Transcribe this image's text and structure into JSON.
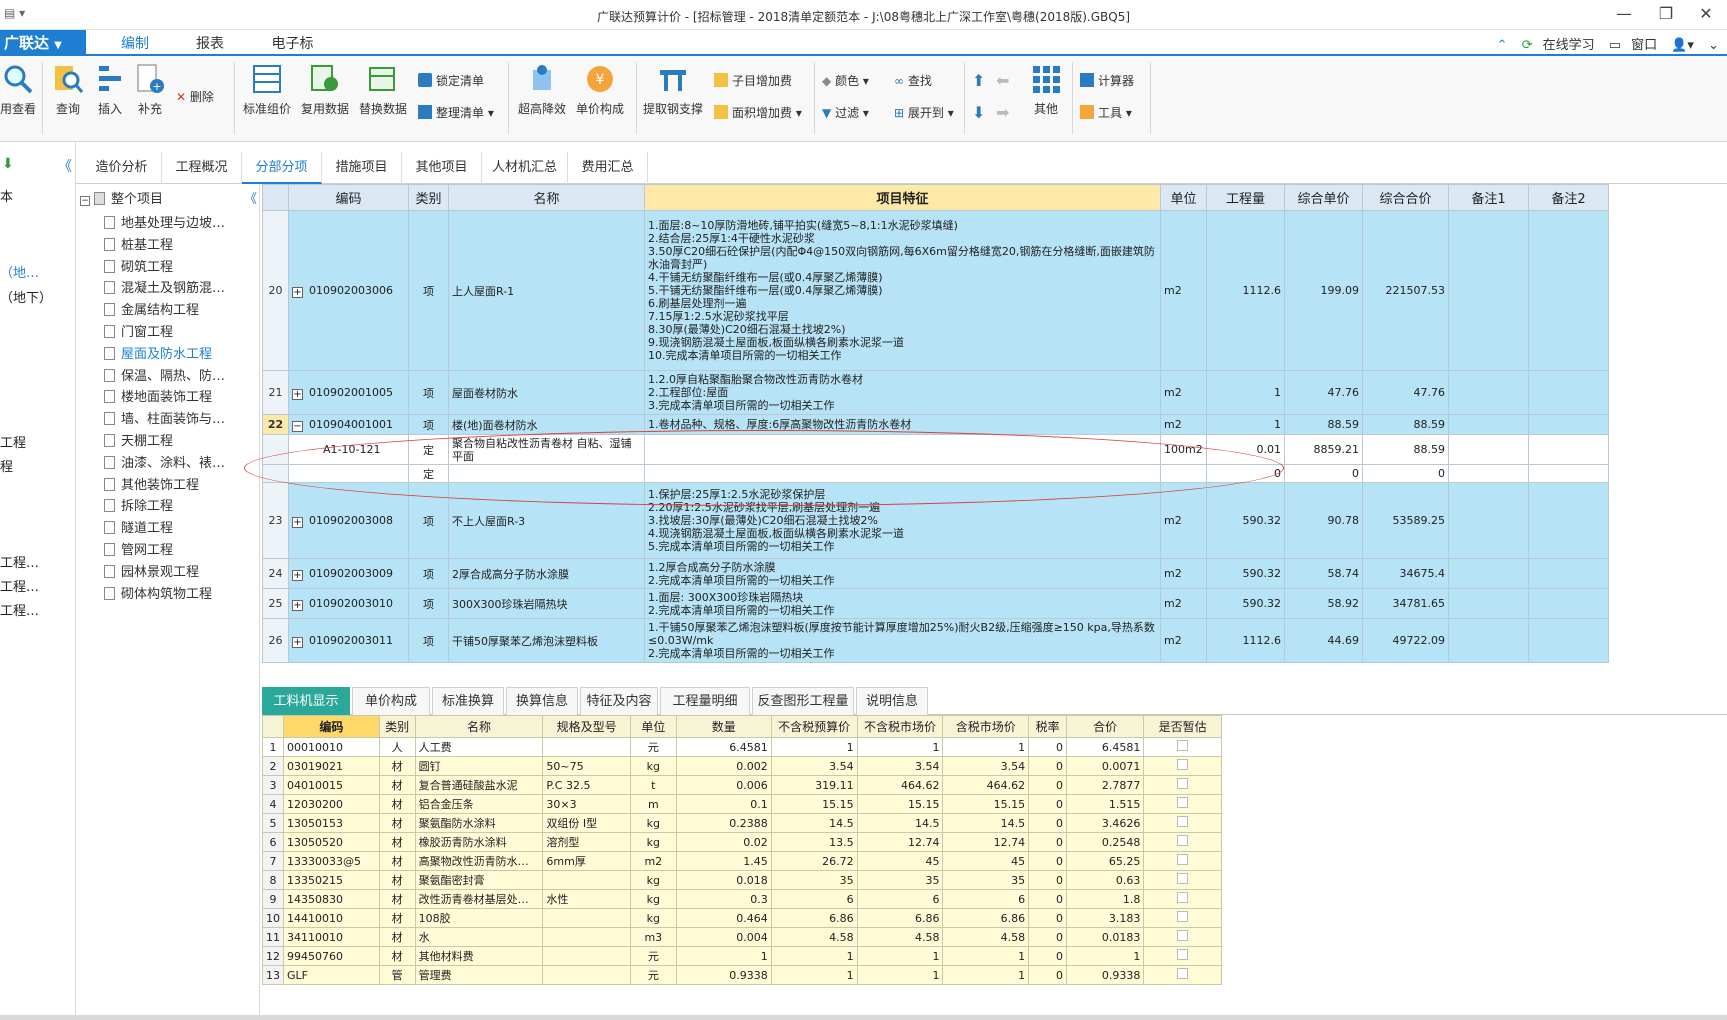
{
  "window": {
    "title": "广联达预算计价 - [招标管理 - 2018清单定额范本 - J:\\08粤穗北上广深工作室\\粤穗(2018版).GBQ5]"
  },
  "menu": {
    "brand": "广联达",
    "tabs": [
      "编制",
      "报表",
      "电子标"
    ],
    "right": {
      "learn": "在线学习",
      "window": "窗口"
    }
  },
  "toolbar": {
    "partial_first": "用查看",
    "query": "查询",
    "insert": "插入",
    "supplement": "补充",
    "delete": "删除",
    "std_price": "标准组价",
    "reuse": "复用数据",
    "replace": "替换数据",
    "lock": "锁定清单",
    "tidy": "整理清单",
    "super_reduce": "超高降效",
    "unit_price": "单价构成",
    "extract_support": "提取钢支撑",
    "sub_add": "子目增加费",
    "area_add": "面积增加费",
    "color": "颜色",
    "find": "查找",
    "filter": "过滤",
    "expand": "展开到",
    "other": "其他",
    "calculator": "计算器",
    "tools": "工具"
  },
  "left_strip": {
    "items": [
      "本",
      "（地…",
      "（地下）",
      "工程",
      "程",
      "工程…",
      "工程…",
      "工程…"
    ]
  },
  "main_tabs": [
    "造价分析",
    "工程概况",
    "分部分项",
    "措施项目",
    "其他项目",
    "人材机汇总",
    "费用汇总"
  ],
  "tree": {
    "root": "整个项目",
    "items": [
      "地基处理与边坡…",
      "桩基工程",
      "砌筑工程",
      "混凝土及钢筋混…",
      "金属结构工程",
      "门窗工程",
      "屋面及防水工程",
      "保温、隔热、防…",
      "楼地面装饰工程",
      "墙、柱面装饰与…",
      "天棚工程",
      "油漆、涂料、裱…",
      "其他装饰工程",
      "拆除工程",
      "隧道工程",
      "管网工程",
      "园林景观工程",
      "砌体构筑物工程"
    ],
    "selected_index": 6
  },
  "grid": {
    "headers": [
      "编码",
      "类别",
      "名称",
      "项目特征",
      "单位",
      "工程量",
      "综合单价",
      "综合合价",
      "备注1",
      "备注2"
    ],
    "rows": [
      {
        "no": "20",
        "code": "010902003006",
        "type": "项",
        "name": "上人屋面R-1",
        "feature": "1.面层:8~10厚防滑地砖,铺平拍实(缝宽5~8,1:1水泥砂浆填缝)\n2.结合层:25厚1:4干硬性水泥砂浆\n3.50厚C20细石砼保护层(内配Φ4@150双向钢筋网,每6X6m留分格缝宽20,钢筋在分格缝断,面嵌建筑防水油膏封严)\n4.干铺无纺聚酯纤维布一层(或0.4厚聚乙烯薄膜)\n5.干铺无纺聚酯纤维布一层(或0.4厚聚乙烯薄膜)\n6.刷基层处理剂一遍\n7.15厚1:2.5水泥砂浆找平层\n8.30厚(最薄处)C20细石混凝土找坡2%)\n9.现浇钢筋混凝土屋面板,板面纵横各刷素水泥浆一道\n10.完成本清单项目所需的一切相关工作",
        "unit": "m2",
        "qty": "1112.6",
        "price": "199.09",
        "total": "221507.53"
      },
      {
        "no": "21",
        "code": "010902001005",
        "type": "项",
        "name": "屋面卷材防水",
        "feature": "1.2.0厚自粘聚酯胎聚合物改性沥青防水卷材\n2.工程部位:屋面\n3.完成本清单项目所需的一切相关工作",
        "unit": "m2",
        "qty": "1",
        "price": "47.76",
        "total": "47.76"
      },
      {
        "no": "22",
        "code": "010904001001",
        "type": "项",
        "name": "楼(地)面卷材防水",
        "feature": "1.卷材品种、规格、厚度:6厚高聚物改性沥青防水卷材",
        "unit": "m2",
        "qty": "1",
        "price": "88.59",
        "total": "88.59"
      },
      {
        "no": "",
        "code": "A1-10-121",
        "type": "定",
        "name": "聚合物自粘改性沥青卷材 自粘、湿铺 平面",
        "feature": "",
        "unit": "100m2",
        "qty": "0.01",
        "price": "8859.21",
        "total": "88.59"
      },
      {
        "no": "",
        "code": "",
        "type": "定",
        "name": "",
        "feature": "",
        "unit": "",
        "qty": "0",
        "price": "0",
        "total": "0"
      },
      {
        "no": "23",
        "code": "010902003008",
        "type": "项",
        "name": "不上人屋面R-3",
        "feature": "1.保护层:25厚1:2.5水泥砂浆保护层\n2.20厚1:2.5水泥砂浆找平层,刷基层处理剂一遍\n3.找坡层:30厚(最薄处)C20细石混凝土找坡2%\n4.现浇钢筋混凝土屋面板,板面纵横各刷素水泥浆一道\n5.完成本清单项目所需的一切相关工作",
        "unit": "m2",
        "qty": "590.32",
        "price": "90.78",
        "total": "53589.25"
      },
      {
        "no": "24",
        "code": "010902003009",
        "type": "项",
        "name": "2厚合成高分子防水涂膜",
        "feature": "1.2厚合成高分子防水涂膜\n2.完成本清单项目所需的一切相关工作",
        "unit": "m2",
        "qty": "590.32",
        "price": "58.74",
        "total": "34675.4"
      },
      {
        "no": "25",
        "code": "010902003010",
        "type": "项",
        "name": "300X300珍珠岩隔热块",
        "feature": "1.面层: 300X300珍珠岩隔热块\n2.完成本清单项目所需的一切相关工作",
        "unit": "m2",
        "qty": "590.32",
        "price": "58.92",
        "total": "34781.65"
      },
      {
        "no": "26",
        "code": "010902003011",
        "type": "项",
        "name": "干铺50厚聚苯乙烯泡沫塑料板",
        "feature": "1.干铺50厚聚苯乙烯泡沫塑料板(厚度按节能计算厚度增加25%)耐火B2级,压缩强度≥150 kpa,导热系数≤0.03W/mk\n2.完成本清单项目所需的一切相关工作",
        "unit": "m2",
        "qty": "1112.6",
        "price": "44.69",
        "total": "49722.09"
      }
    ]
  },
  "bottom_tabs": [
    "工料机显示",
    "单价构成",
    "标准换算",
    "换算信息",
    "特征及内容",
    "工程量明细",
    "反查图形工程量",
    "说明信息"
  ],
  "bottom_grid": {
    "headers": [
      "编码",
      "类别",
      "名称",
      "规格及型号",
      "单位",
      "数量",
      "不含税预算价",
      "不含税市场价",
      "含税市场价",
      "税率",
      "合价",
      "是否暂估"
    ],
    "rows": [
      [
        "1",
        "00010010",
        "人",
        "人工费",
        "",
        "元",
        "6.4581",
        "1",
        "1",
        "1",
        "0",
        "6.4581"
      ],
      [
        "2",
        "03019021",
        "材",
        "圆钉",
        "50~75",
        "kg",
        "0.002",
        "3.54",
        "3.54",
        "3.54",
        "0",
        "0.0071"
      ],
      [
        "3",
        "04010015",
        "材",
        "复合普通硅酸盐水泥",
        "P.C 32.5",
        "t",
        "0.006",
        "319.11",
        "464.62",
        "464.62",
        "0",
        "2.7877"
      ],
      [
        "4",
        "12030200",
        "材",
        "铝合金压条",
        "30×3",
        "m",
        "0.1",
        "15.15",
        "15.15",
        "15.15",
        "0",
        "1.515"
      ],
      [
        "5",
        "13050153",
        "材",
        "聚氨酯防水涂料",
        "双组份 I型",
        "kg",
        "0.2388",
        "14.5",
        "14.5",
        "14.5",
        "0",
        "3.4626"
      ],
      [
        "6",
        "13050520",
        "材",
        "橡胶沥青防水涂料",
        "溶剂型",
        "kg",
        "0.02",
        "13.5",
        "12.74",
        "12.74",
        "0",
        "0.2548"
      ],
      [
        "7",
        "13330033@5",
        "材",
        "高聚物改性沥青防水…",
        "6mm厚",
        "m2",
        "1.45",
        "26.72",
        "45",
        "45",
        "0",
        "65.25"
      ],
      [
        "8",
        "13350215",
        "材",
        "聚氨酯密封膏",
        "",
        "kg",
        "0.018",
        "35",
        "35",
        "35",
        "0",
        "0.63"
      ],
      [
        "9",
        "14350830",
        "材",
        "改性沥青卷材基层处…",
        "水性",
        "kg",
        "0.3",
        "6",
        "6",
        "6",
        "0",
        "1.8"
      ],
      [
        "10",
        "14410010",
        "材",
        "108胶",
        "",
        "kg",
        "0.464",
        "6.86",
        "6.86",
        "6.86",
        "0",
        "3.183"
      ],
      [
        "11",
        "34110010",
        "材",
        "水",
        "",
        "m3",
        "0.004",
        "4.58",
        "4.58",
        "4.58",
        "0",
        "0.0183"
      ],
      [
        "12",
        "99450760",
        "材",
        "其他材料费",
        "",
        "元",
        "1",
        "1",
        "1",
        "1",
        "0",
        "1"
      ],
      [
        "13",
        "GLF",
        "管",
        "管理费",
        "",
        "元",
        "0.9338",
        "1",
        "1",
        "1",
        "0",
        "0.9338"
      ]
    ]
  }
}
